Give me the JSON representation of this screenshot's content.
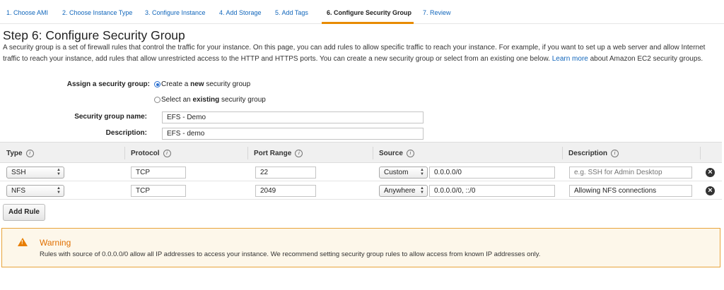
{
  "wizard": {
    "tabs": [
      {
        "label": "1. Choose AMI"
      },
      {
        "label": "2. Choose Instance Type"
      },
      {
        "label": "3. Configure Instance"
      },
      {
        "label": "4. Add Storage"
      },
      {
        "label": "5. Add Tags"
      },
      {
        "label": "6. Configure Security Group"
      },
      {
        "label": "7. Review"
      }
    ],
    "active_tab": "6. Configure Security Group",
    "accent_color": "#e88b00"
  },
  "page": {
    "title": "Step 6: Configure Security Group",
    "intro_text": "A security group is a set of firewall rules that control the traffic for your instance. On this page, you can add rules to allow specific traffic to reach your instance. For example, if you want to set up a web server and allow Internet traffic to reach your instance, add rules that allow unrestricted access to the HTTP and HTTPS ports. You can create a new security group or select from an existing one below.",
    "learn_more": "Learn more",
    "intro_suffix": "about Amazon EC2 security groups."
  },
  "assign": {
    "label": "Assign a security group:",
    "option_new_prefix": "Create a ",
    "option_new_bold": "new",
    "option_new_suffix": " security group",
    "option_existing_prefix": "Select an ",
    "option_existing_bold": "existing",
    "option_existing_suffix": " security group",
    "selected": "new"
  },
  "form": {
    "name_label": "Security group name:",
    "name_value": "EFS - Demo",
    "description_label": "Description:",
    "description_value": "EFS - demo"
  },
  "table": {
    "headers": {
      "type": "Type",
      "protocol": "Protocol",
      "port_range": "Port Range",
      "source": "Source",
      "description": "Description"
    },
    "info_glyph": "i",
    "rows": [
      {
        "type": "SSH",
        "protocol": "TCP",
        "port_range": "22",
        "source_mode": "Custom",
        "source_value": "0.0.0.0/0",
        "description": "",
        "description_placeholder": "e.g. SSH for Admin Desktop"
      },
      {
        "type": "NFS",
        "protocol": "TCP",
        "port_range": "2049",
        "source_mode": "Anywhere",
        "source_value": "0.0.0.0/0, ::/0",
        "description": "Allowing NFS connections",
        "description_placeholder": ""
      }
    ],
    "remove_icon": "close-circle-icon"
  },
  "add_rule_label": "Add Rule",
  "warning": {
    "title": "Warning",
    "icon": "warning-triangle-icon",
    "text": "Rules with source of 0.0.0.0/0 allow all IP addresses to access your instance. We recommend setting security group rules to allow access from known IP addresses only.",
    "color": "#e87e00"
  }
}
